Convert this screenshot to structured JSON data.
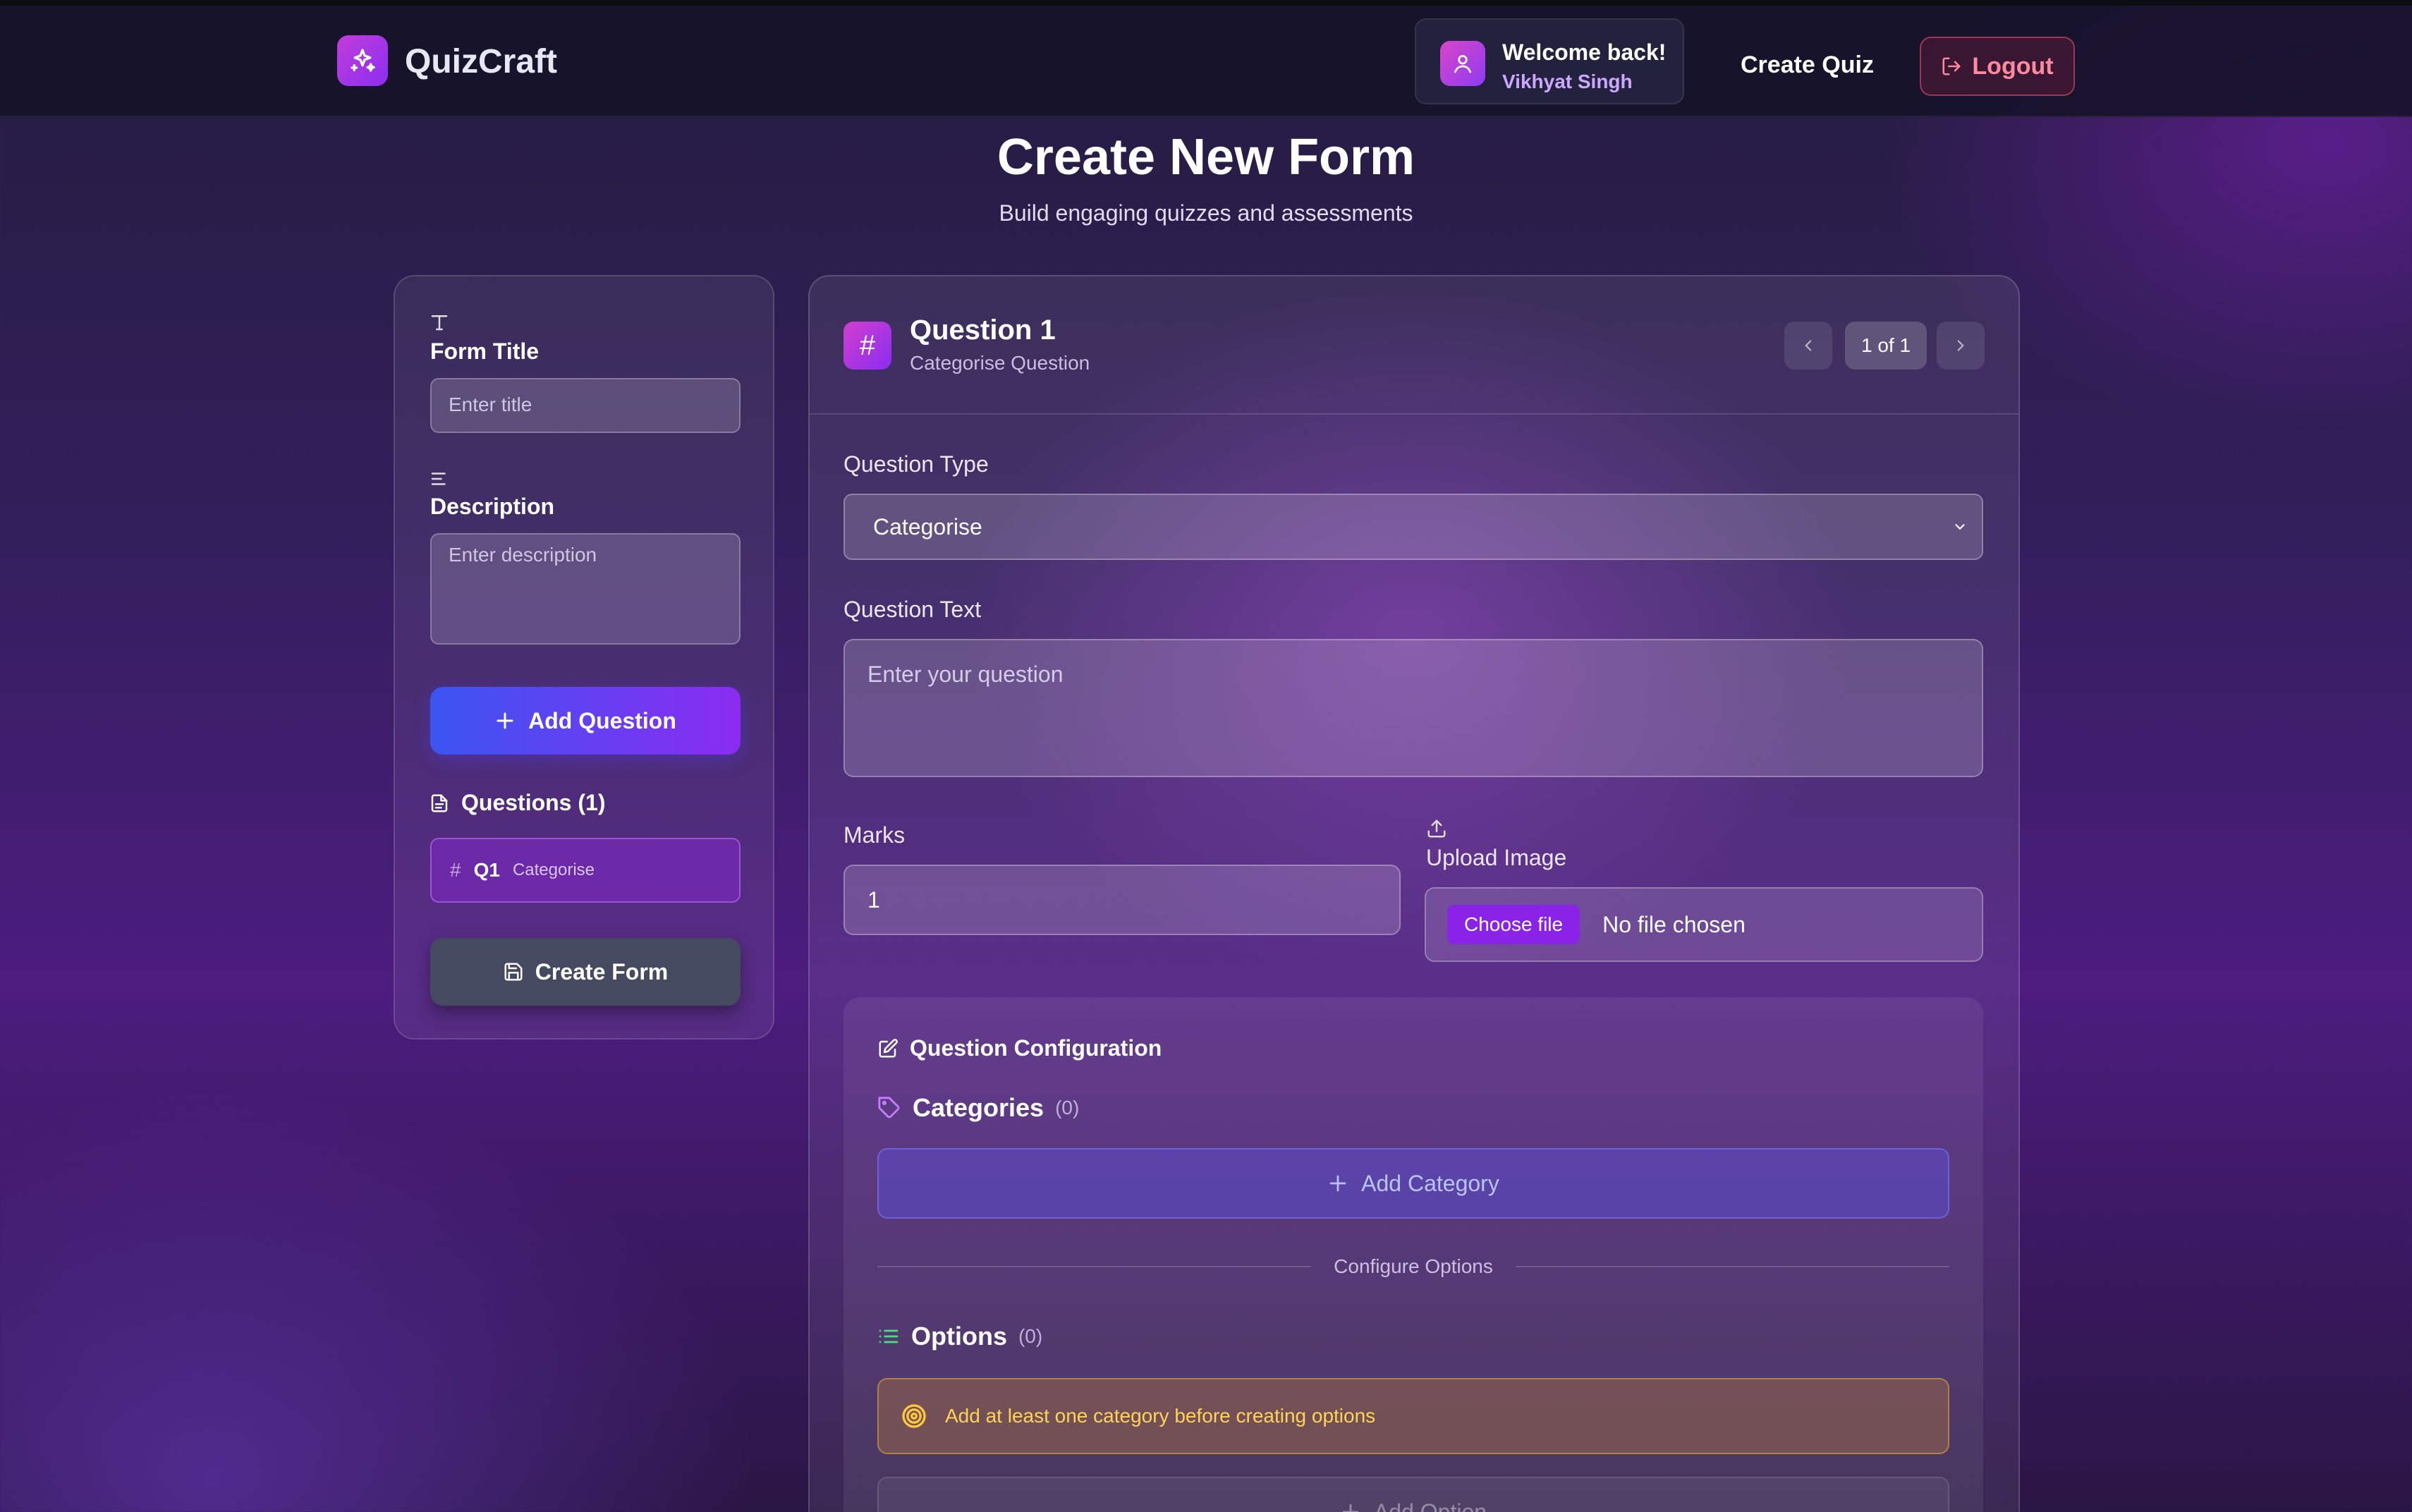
{
  "app": {
    "name": "QuizCraft"
  },
  "nav": {
    "welcome": "Welcome back!",
    "user_name": "Vikhyat Singh",
    "create_quiz": "Create Quiz",
    "logout": "Logout"
  },
  "header": {
    "title": "Create New Form",
    "subtitle": "Build engaging quizzes and assessments"
  },
  "sidebar": {
    "form_title_label": "Form Title",
    "form_title_placeholder": "Enter title",
    "description_label": "Description",
    "description_placeholder": "Enter description",
    "add_question": "Add Question",
    "questions_heading": "Questions (1)",
    "questions": [
      {
        "number": "Q1",
        "type": "Categorise"
      }
    ],
    "create_form": "Create Form"
  },
  "editor": {
    "question_title": "Question 1",
    "question_subtitle": "Categorise Question",
    "pager": "1 of 1",
    "question_type_label": "Question Type",
    "question_type_value": "Categorise",
    "question_text_label": "Question Text",
    "question_text_placeholder": "Enter your question",
    "marks_label": "Marks",
    "marks_value": "1",
    "upload_label": "Upload Image",
    "choose_file": "Choose file",
    "no_file": "No file chosen",
    "config": {
      "heading": "Question Configuration",
      "categories_label": "Categories",
      "categories_count": "(0)",
      "add_category": "Add Category",
      "divider_text": "Configure Options",
      "options_label": "Options",
      "options_count": "(0)",
      "warning": "Add at least one category before creating options",
      "add_option": "Add Option"
    }
  },
  "colors": {
    "brand_gradient_start": "#c13ddb",
    "brand_gradient_end": "#8b2ef0",
    "primary_button_start": "#3b55f0",
    "primary_button_end": "#8b2cf0",
    "logout_red": "#ff8aa0",
    "warning_yellow": "#ffd35a",
    "category_blue": "#b9c4ff"
  }
}
